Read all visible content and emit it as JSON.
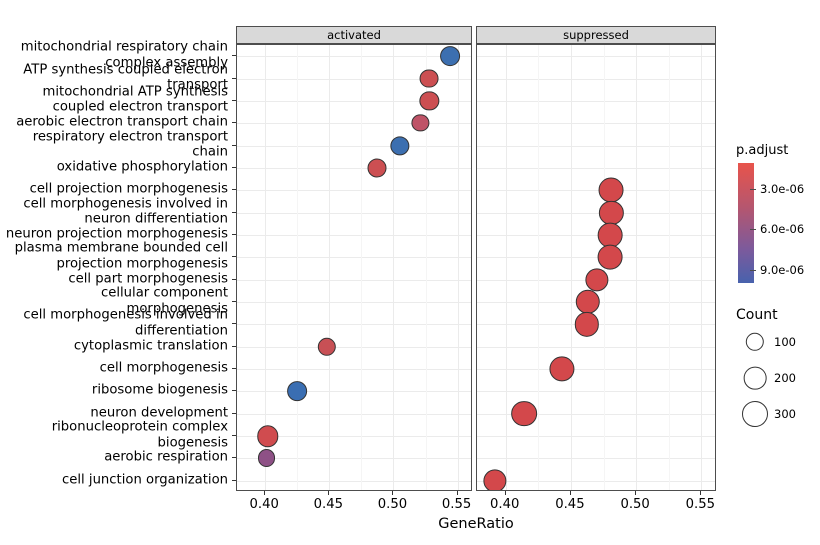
{
  "chart_data": {
    "type": "scatter",
    "subtype": "dotplot",
    "title": "",
    "xlabel": "GeneRatio",
    "ylabel": "",
    "xlim": [
      0.378,
      0.562
    ],
    "xticks": [
      0.4,
      0.45,
      0.5,
      0.55
    ],
    "xtick_labels": [
      "0.40",
      "0.45",
      "0.50",
      "0.55"
    ],
    "grid": true,
    "facets": [
      {
        "key": "activated",
        "label": "activated"
      },
      {
        "key": "suppressed",
        "label": "suppressed"
      }
    ],
    "categories": [
      "mitochondrial respiratory chain complex assembly",
      "ATP synthesis coupled electron transport",
      "mitochondrial ATP synthesis coupled electron transport",
      "aerobic electron transport chain",
      "respiratory electron transport chain",
      "oxidative phosphorylation",
      "cell projection morphogenesis",
      "cell morphogenesis involved in neuron differentiation",
      "neuron projection morphogenesis",
      "plasma membrane bounded cell projection morphogenesis",
      "cell part morphogenesis",
      "cellular component morphogenesis",
      "cell morphogenesis involved in differentiation",
      "cytoplasmic translation",
      "cell morphogenesis",
      "ribosome biogenesis",
      "neuron development",
      "ribonucleoprotein complex biogenesis",
      "aerobic respiration",
      "cell junction organization"
    ],
    "points": [
      {
        "facet": "activated",
        "category": "mitochondrial respiratory chain complex assembly",
        "gene_ratio": 0.544,
        "count": 130,
        "p_adjust": 8.4e-06,
        "color": "#3c6fb0"
      },
      {
        "facet": "activated",
        "category": "ATP synthesis coupled electron transport",
        "gene_ratio": 0.528,
        "count": 110,
        "p_adjust": 2.4e-06,
        "color": "#cc4f52"
      },
      {
        "facet": "activated",
        "category": "mitochondrial ATP synthesis coupled electron transport",
        "gene_ratio": 0.528,
        "count": 118,
        "p_adjust": 2.4e-06,
        "color": "#cc4f52"
      },
      {
        "facet": "activated",
        "category": "aerobic electron transport chain",
        "gene_ratio": 0.521,
        "count": 78,
        "p_adjust": 3.5e-06,
        "color": "#bf5367"
      },
      {
        "facet": "activated",
        "category": "respiratory electron transport chain",
        "gene_ratio": 0.505,
        "count": 118,
        "p_adjust": 8.7e-06,
        "color": "#3c6fb0"
      },
      {
        "facet": "activated",
        "category": "oxidative phosphorylation",
        "gene_ratio": 0.487,
        "count": 112,
        "p_adjust": 2.6e-06,
        "color": "#cc4f52"
      },
      {
        "facet": "activated",
        "category": "cytoplasmic translation",
        "gene_ratio": 0.448,
        "count": 100,
        "p_adjust": 2.8e-06,
        "color": "#c85055"
      },
      {
        "facet": "activated",
        "category": "ribosome biogenesis",
        "gene_ratio": 0.425,
        "count": 128,
        "p_adjust": 9e-06,
        "color": "#3a6eb2"
      },
      {
        "facet": "activated",
        "category": "ribonucleoprotein complex biogenesis",
        "gene_ratio": 0.402,
        "count": 168,
        "p_adjust": 2.2e-06,
        "color": "#d04c4f"
      },
      {
        "facet": "activated",
        "category": "aerobic respiration",
        "gene_ratio": 0.401,
        "count": 92,
        "p_adjust": 6.7e-06,
        "color": "#8e5186"
      },
      {
        "facet": "suppressed",
        "category": "cell projection morphogenesis",
        "gene_ratio": 0.481,
        "count": 265,
        "p_adjust": 1.1e-06,
        "color": "#d3484b"
      },
      {
        "facet": "suppressed",
        "category": "cell morphogenesis involved in neuron differentiation",
        "gene_ratio": 0.481,
        "count": 245,
        "p_adjust": 1.1e-06,
        "color": "#d3484b"
      },
      {
        "facet": "suppressed",
        "category": "neuron projection morphogenesis",
        "gene_ratio": 0.48,
        "count": 258,
        "p_adjust": 1.1e-06,
        "color": "#d3484b"
      },
      {
        "facet": "suppressed",
        "category": "plasma membrane bounded cell projection morphogenesis",
        "gene_ratio": 0.48,
        "count": 262,
        "p_adjust": 1.1e-06,
        "color": "#d3484b"
      },
      {
        "facet": "suppressed",
        "category": "cell part morphogenesis",
        "gene_ratio": 0.47,
        "count": 215,
        "p_adjust": 1.1e-06,
        "color": "#d3484b"
      },
      {
        "facet": "suppressed",
        "category": "cellular component morphogenesis",
        "gene_ratio": 0.463,
        "count": 250,
        "p_adjust": 1.1e-06,
        "color": "#d3484b"
      },
      {
        "facet": "suppressed",
        "category": "cell morphogenesis involved in differentiation",
        "gene_ratio": 0.462,
        "count": 248,
        "p_adjust": 1.1e-06,
        "color": "#d3484b"
      },
      {
        "facet": "suppressed",
        "category": "cell morphogenesis",
        "gene_ratio": 0.443,
        "count": 272,
        "p_adjust": 1.1e-06,
        "color": "#d3484b"
      },
      {
        "facet": "suppressed",
        "category": "neuron development",
        "gene_ratio": 0.414,
        "count": 290,
        "p_adjust": 1.1e-06,
        "color": "#d3484b"
      },
      {
        "facet": "suppressed",
        "category": "cell junction organization",
        "gene_ratio": 0.392,
        "count": 215,
        "p_adjust": 1.1e-06,
        "color": "#d3484b"
      }
    ],
    "legends": {
      "color": {
        "title": "p.adjust",
        "ticks": [
          3e-06,
          6e-06,
          9e-06
        ],
        "tick_labels": [
          "3.0e-06",
          "6.0e-06",
          "9.0e-06"
        ],
        "low_color": "#e8544b",
        "high_color": "#4862ad",
        "range": [
          1.1e-06,
          1e-05
        ]
      },
      "size": {
        "title": "Count",
        "breaks": [
          100,
          200,
          300
        ],
        "break_labels": [
          "100",
          "200",
          "300"
        ]
      }
    }
  }
}
